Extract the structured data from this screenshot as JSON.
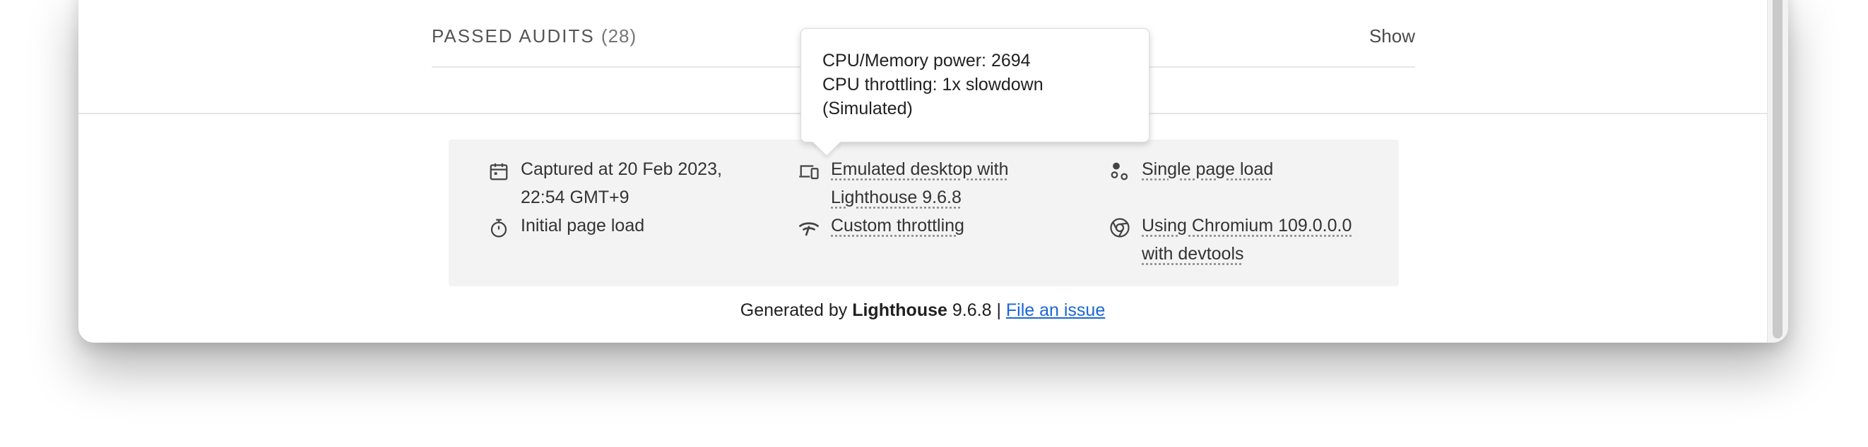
{
  "audits": {
    "passed_label": "PASSED AUDITS",
    "passed_count": "(28)",
    "show_label": "Show"
  },
  "tooltip": {
    "line1": "CPU/Memory power: 2694",
    "line2": "CPU throttling: 1x slowdown",
    "line3": "(Simulated)"
  },
  "environment": {
    "captured_line1": "Captured at 20 Feb 2023,",
    "captured_line2": "22:54 GMT+9",
    "initial_load": "Initial page load",
    "emulated_line1": "Emulated desktop with",
    "emulated_line2": "Lighthouse 9.6.8",
    "throttling": "Custom throttling",
    "single_load": "Single page load",
    "chromium_line1": "Using Chromium 109.0.0.0",
    "chromium_line2": "with devtools"
  },
  "icons": {
    "calendar": "calendar-icon",
    "timer": "stopwatch-icon",
    "devices": "devices-icon",
    "throttling": "wifi-throttling-icon",
    "single_load": "single-load-icon",
    "chromium": "chromium-icon"
  },
  "footer": {
    "generated_by": "Generated by",
    "product": "Lighthouse",
    "version": "9.6.8",
    "separator": "|",
    "issue_link": "File an issue"
  },
  "colors": {
    "link": "#1a66d6",
    "env_bg": "#f3f3f3"
  }
}
